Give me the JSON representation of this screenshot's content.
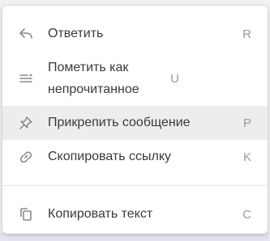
{
  "menu": {
    "items": [
      {
        "icon": "reply-icon",
        "label": "Ответить",
        "shortcut": "R"
      },
      {
        "icon": "mark-unread-icon",
        "label": "Пометить как непрочитанное",
        "shortcut": "U"
      },
      {
        "icon": "pin-icon",
        "label": "Прикрепить сообщение",
        "shortcut": "P",
        "highlighted": true
      },
      {
        "icon": "link-icon",
        "label": "Скопировать ссылку",
        "shortcut": "K"
      },
      {
        "icon": "copy-icon",
        "label": "Копировать текст",
        "shortcut": "C"
      }
    ]
  },
  "colors": {
    "highlight": "#ededed",
    "text": "#3a3a3a",
    "shortcut": "#9a9a9a",
    "icon": "#8a8a8a"
  }
}
